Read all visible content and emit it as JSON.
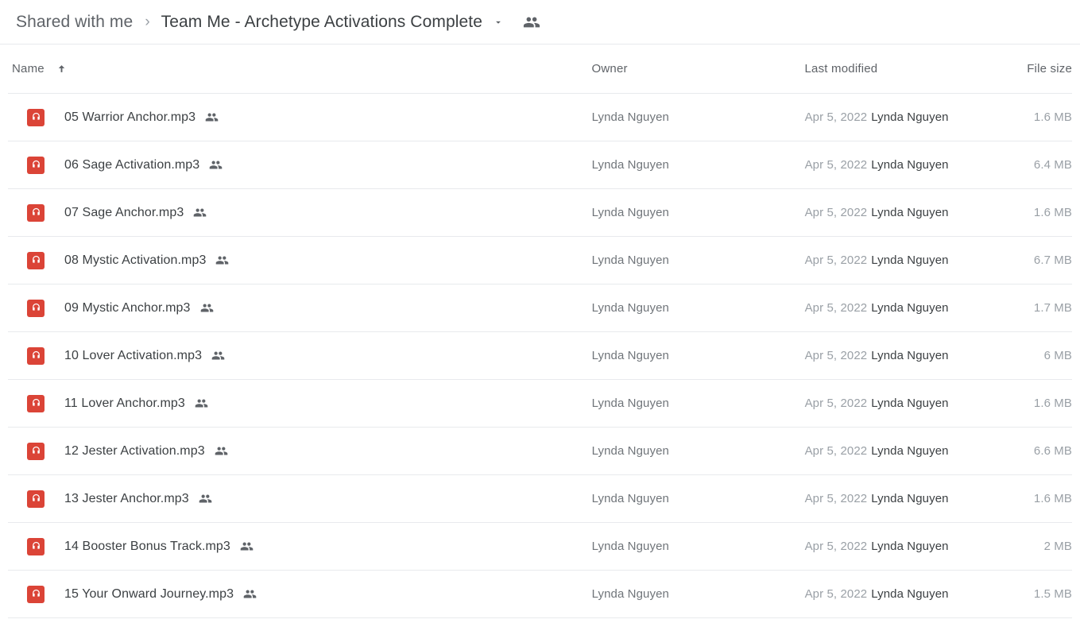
{
  "breadcrumb": {
    "root_label": "Shared with me",
    "separator": "›",
    "current_label": "Team Me - Archetype Activations Complete",
    "caret_icon": "chevron-down-icon",
    "shared_icon": "people-shared-icon"
  },
  "columns": {
    "name": "Name",
    "owner": "Owner",
    "last_modified": "Last modified",
    "file_size": "File size",
    "sort_icon": "arrow-up-icon",
    "sort_direction": "ascending"
  },
  "colors": {
    "audio_icon_bg": "#db4437",
    "divider": "#e8eaed",
    "text_primary": "#3c4043",
    "text_secondary": "#5f6368",
    "text_muted": "#9aa0a6"
  },
  "files": [
    {
      "name": "05 Warrior Anchor.mp3",
      "icon": "audio-file-icon",
      "shared_icon": "people-shared-icon",
      "owner": "Lynda Nguyen",
      "modified_date": "Apr 5, 2022",
      "modified_by": "Lynda Nguyen",
      "size": "1.6 MB"
    },
    {
      "name": "06 Sage Activation.mp3",
      "icon": "audio-file-icon",
      "shared_icon": "people-shared-icon",
      "owner": "Lynda Nguyen",
      "modified_date": "Apr 5, 2022",
      "modified_by": "Lynda Nguyen",
      "size": "6.4 MB"
    },
    {
      "name": "07 Sage Anchor.mp3",
      "icon": "audio-file-icon",
      "shared_icon": "people-shared-icon",
      "owner": "Lynda Nguyen",
      "modified_date": "Apr 5, 2022",
      "modified_by": "Lynda Nguyen",
      "size": "1.6 MB"
    },
    {
      "name": "08 Mystic Activation.mp3",
      "icon": "audio-file-icon",
      "shared_icon": "people-shared-icon",
      "owner": "Lynda Nguyen",
      "modified_date": "Apr 5, 2022",
      "modified_by": "Lynda Nguyen",
      "size": "6.7 MB"
    },
    {
      "name": "09 Mystic Anchor.mp3",
      "icon": "audio-file-icon",
      "shared_icon": "people-shared-icon",
      "owner": "Lynda Nguyen",
      "modified_date": "Apr 5, 2022",
      "modified_by": "Lynda Nguyen",
      "size": "1.7 MB"
    },
    {
      "name": "10 Lover Activation.mp3",
      "icon": "audio-file-icon",
      "shared_icon": "people-shared-icon",
      "owner": "Lynda Nguyen",
      "modified_date": "Apr 5, 2022",
      "modified_by": "Lynda Nguyen",
      "size": "6 MB"
    },
    {
      "name": "11 Lover Anchor.mp3",
      "icon": "audio-file-icon",
      "shared_icon": "people-shared-icon",
      "owner": "Lynda Nguyen",
      "modified_date": "Apr 5, 2022",
      "modified_by": "Lynda Nguyen",
      "size": "1.6 MB"
    },
    {
      "name": "12 Jester Activation.mp3",
      "icon": "audio-file-icon",
      "shared_icon": "people-shared-icon",
      "owner": "Lynda Nguyen",
      "modified_date": "Apr 5, 2022",
      "modified_by": "Lynda Nguyen",
      "size": "6.6 MB"
    },
    {
      "name": "13 Jester Anchor.mp3",
      "icon": "audio-file-icon",
      "shared_icon": "people-shared-icon",
      "owner": "Lynda Nguyen",
      "modified_date": "Apr 5, 2022",
      "modified_by": "Lynda Nguyen",
      "size": "1.6 MB"
    },
    {
      "name": "14 Booster Bonus Track.mp3",
      "icon": "audio-file-icon",
      "shared_icon": "people-shared-icon",
      "owner": "Lynda Nguyen",
      "modified_date": "Apr 5, 2022",
      "modified_by": "Lynda Nguyen",
      "size": "2 MB"
    },
    {
      "name": "15 Your Onward Journey.mp3",
      "icon": "audio-file-icon",
      "shared_icon": "people-shared-icon",
      "owner": "Lynda Nguyen",
      "modified_date": "Apr 5, 2022",
      "modified_by": "Lynda Nguyen",
      "size": "1.5 MB"
    }
  ]
}
